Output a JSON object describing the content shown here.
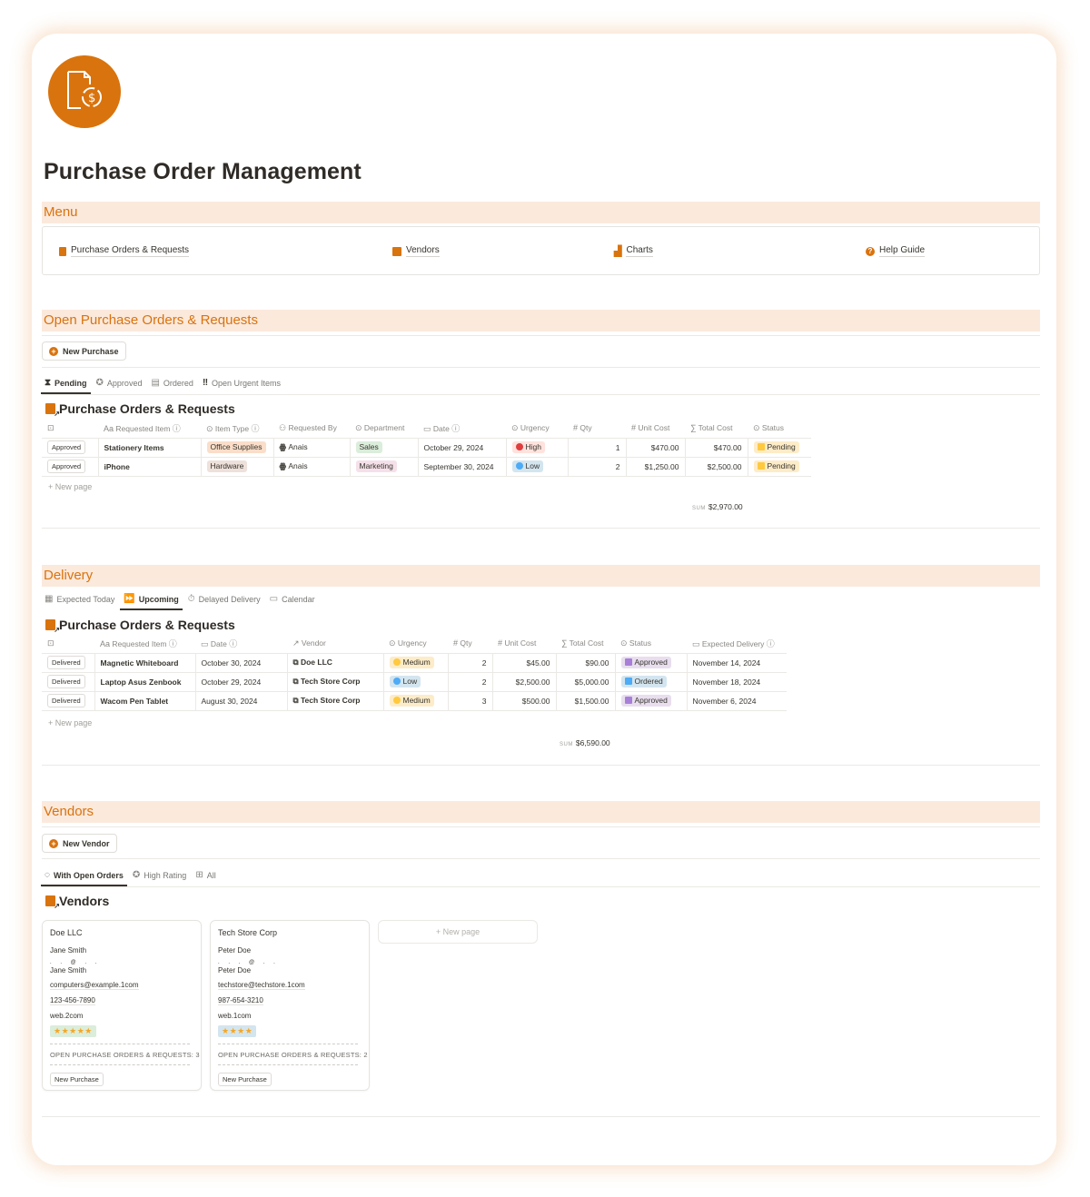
{
  "page": {
    "title": "Purchase Order Management",
    "icon": "invoice-exchange-icon"
  },
  "colors": {
    "accent": "#d9730d",
    "section_bg": "#fbe9dc",
    "text": "#37352f"
  },
  "menu": {
    "heading": "Menu",
    "items": [
      {
        "label": "Purchase Orders & Requests",
        "icon": "receipt-icon"
      },
      {
        "label": "Vendors",
        "icon": "store-icon"
      },
      {
        "label": "Charts",
        "icon": "chart-icon"
      },
      {
        "label": "Help Guide",
        "icon": "help-icon"
      }
    ]
  },
  "open_orders": {
    "heading": "Open Purchase Orders & Requests",
    "new_button": "New Purchase",
    "tabs": [
      {
        "label": "Pending",
        "icon": "hourglass-icon",
        "active": true
      },
      {
        "label": "Approved",
        "icon": "badge-check-icon",
        "active": false
      },
      {
        "label": "Ordered",
        "icon": "receipt-icon",
        "active": false
      },
      {
        "label": "Open Urgent Items",
        "icon": "double-exclamation-icon",
        "active": false
      }
    ],
    "db_title": "Purchase Orders & Requests",
    "columns": [
      "",
      "Requested Item",
      "Item Type",
      "Requested By",
      "Department",
      "Date",
      "Urgency",
      "Qty",
      "Unit Cost",
      "Total Cost",
      "Status"
    ],
    "rows": [
      {
        "action": "Approved",
        "item": "Stationery Items",
        "item_type": "Office Supplies",
        "requested_by": "Anais",
        "department": "Sales",
        "date": "October 29, 2024",
        "urgency": "High",
        "qty": "1",
        "unit_cost": "$470.00",
        "total_cost": "$470.00",
        "status": "Pending"
      },
      {
        "action": "Approved",
        "item": "iPhone",
        "item_type": "Hardware",
        "requested_by": "Anais",
        "department": "Marketing",
        "date": "September 30, 2024",
        "urgency": "Low",
        "qty": "2",
        "unit_cost": "$1,250.00",
        "total_cost": "$2,500.00",
        "status": "Pending"
      }
    ],
    "new_page": "New page",
    "sum_label": "SUM",
    "sum_value": "$2,970.00"
  },
  "delivery": {
    "heading": "Delivery",
    "tabs": [
      {
        "label": "Expected Today",
        "icon": "calendar-check-icon",
        "active": false
      },
      {
        "label": "Upcoming",
        "icon": "fast-forward-icon",
        "active": true
      },
      {
        "label": "Delayed Delivery",
        "icon": "stopwatch-icon",
        "active": false
      },
      {
        "label": "Calendar",
        "icon": "calendar-icon",
        "active": false
      }
    ],
    "db_title": "Purchase Orders & Requests",
    "columns": [
      "",
      "Requested Item",
      "Date",
      "Vendor",
      "Urgency",
      "Qty",
      "Unit Cost",
      "Total Cost",
      "Status",
      "Expected Delivery"
    ],
    "rows": [
      {
        "action": "Delivered",
        "item": "Magnetic Whiteboard",
        "date": "October 30, 2024",
        "vendor": "Doe LLC",
        "urgency": "Medium",
        "qty": "2",
        "unit_cost": "$45.00",
        "total_cost": "$90.00",
        "status": "Approved",
        "expected": "November 14, 2024"
      },
      {
        "action": "Delivered",
        "item": "Laptop Asus Zenbook",
        "date": "October 29, 2024",
        "vendor": "Tech Store Corp",
        "urgency": "Low",
        "qty": "2",
        "unit_cost": "$2,500.00",
        "total_cost": "$5,000.00",
        "status": "Ordered",
        "expected": "November 18, 2024"
      },
      {
        "action": "Delivered",
        "item": "Wacom Pen Tablet",
        "date": "August 30, 2024",
        "vendor": "Tech Store Corp",
        "urgency": "Medium",
        "qty": "3",
        "unit_cost": "$500.00",
        "total_cost": "$1,500.00",
        "status": "Approved",
        "expected": "November 6, 2024"
      }
    ],
    "new_page": "New page",
    "sum_label": "SUM",
    "sum_value": "$6,590.00"
  },
  "vendors": {
    "heading": "Vendors",
    "new_button": "New Vendor",
    "tabs": [
      {
        "label": "With Open Orders",
        "icon": "dashed-circle-icon",
        "active": true
      },
      {
        "label": "High Rating",
        "icon": "star-badge-icon",
        "active": false
      },
      {
        "label": "All",
        "icon": "grid-icon",
        "active": false
      }
    ],
    "db_title": "Vendors",
    "cards": [
      {
        "name": "Doe LLC",
        "contact": "Jane Smith",
        "contact2": "Jane Smith",
        "email": "computers@example.1com",
        "phone": "123-456-7890",
        "website": "web.2com",
        "rating": "★★★★★",
        "rating_value": 5,
        "open_label": "OPEN PURCHASE ORDERS & REQUESTS: 3",
        "button": "New Purchase"
      },
      {
        "name": "Tech Store Corp",
        "contact": "Peter Doe",
        "contact2": "Peter Doe",
        "email": "techstore@techstore.1com",
        "phone": "987-654-3210",
        "website": "web.1com",
        "rating": "★★★★",
        "rating_value": 4,
        "open_label": "OPEN PURCHASE ORDERS & REQUESTS: 2",
        "button": "New Purchase"
      }
    ],
    "new_page": "New page"
  }
}
